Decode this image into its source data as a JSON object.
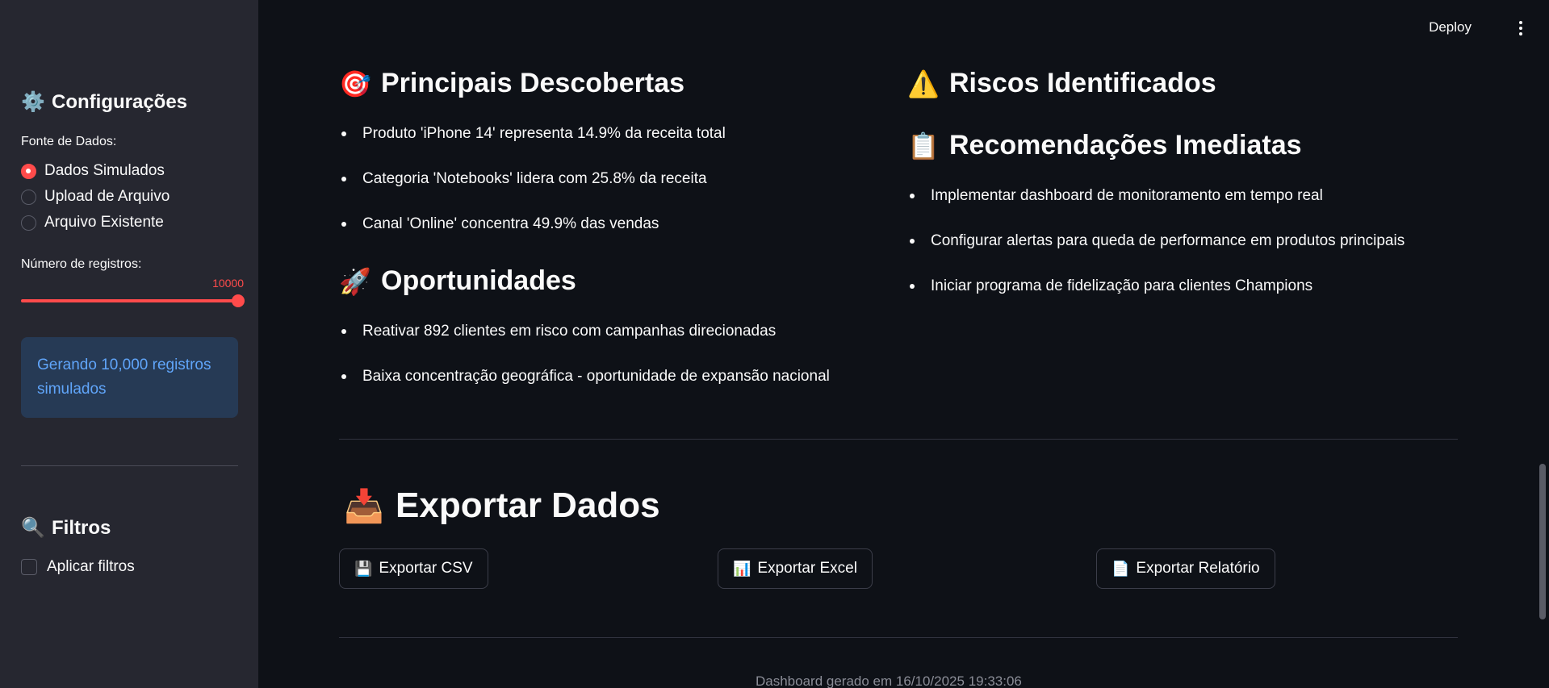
{
  "sidebar": {
    "config_heading": "Configurações",
    "config_icon": "gear-icon",
    "source_label": "Fonte de Dados:",
    "source_options": [
      {
        "label": "Dados Simulados",
        "selected": true
      },
      {
        "label": "Upload de Arquivo",
        "selected": false
      },
      {
        "label": "Arquivo Existente",
        "selected": false
      }
    ],
    "records_label": "Número de registros:",
    "records_value": "10000",
    "records_slider_fraction": 1.0,
    "info_text": "Gerando 10,000 registros simulados",
    "filters_heading": "Filtros",
    "filters_icon": "magnifier-icon",
    "apply_filters_label": "Aplicar filtros"
  },
  "topbar": {
    "deploy_label": "Deploy"
  },
  "main": {
    "discoveries": {
      "heading": "Principais Descobertas",
      "items": [
        "Produto 'iPhone 14' representa 14.9% da receita total",
        "Categoria 'Notebooks' lidera com 25.8% da receita",
        "Canal 'Online' concentra 49.9% das vendas"
      ]
    },
    "opportunities": {
      "heading": "Oportunidades",
      "items": [
        "Reativar 892 clientes em risco com campanhas direcionadas",
        "Baixa concentração geográfica - oportunidade de expansão nacional"
      ]
    },
    "risks": {
      "heading": "Riscos Identificados"
    },
    "recommendations": {
      "heading": "Recomendações Imediatas",
      "items": [
        "Implementar dashboard de monitoramento em tempo real",
        "Configurar alertas para queda de performance em produtos principais",
        "Iniciar programa de fidelização para clientes Champions"
      ]
    },
    "export": {
      "heading": "Exportar Dados",
      "csv_label": "Exportar CSV",
      "excel_label": "Exportar Excel",
      "report_label": "Exportar Relatório"
    },
    "footer": "Dashboard gerado em 16/10/2025 19:33:06"
  }
}
